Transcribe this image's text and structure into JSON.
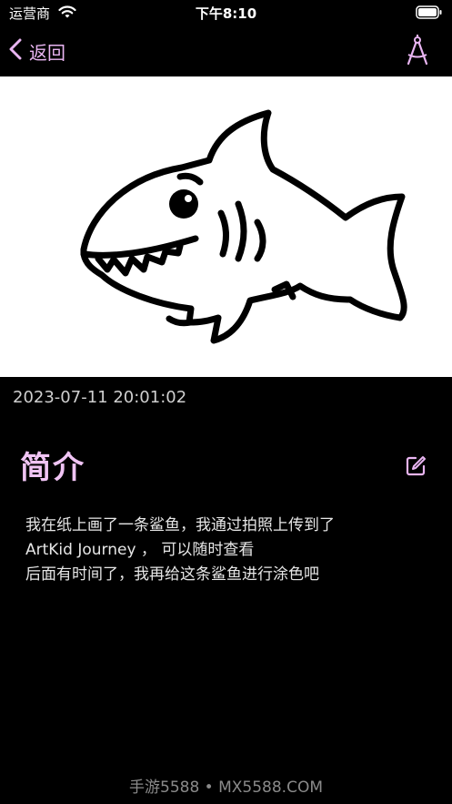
{
  "status_bar": {
    "carrier": "运营商",
    "time": "下午8:10"
  },
  "nav": {
    "back_label": "返回",
    "accent_color": "#e9b5f2",
    "right_icon": "compass-icon"
  },
  "artwork": {
    "subject": "shark-drawing",
    "background": "#ffffff"
  },
  "timestamp": "2023-07-11 20:01:02",
  "intro": {
    "title": "简介",
    "edit_icon": "edit-icon",
    "lines": [
      "我在纸上画了一条鲨鱼，我通过拍照上传到了",
      "ArtKid Journey ， 可以随时查看",
      "后面有时间了，我再给这条鲨鱼进行涂色吧"
    ]
  },
  "watermark": "手游5588 • MX5588.COM"
}
